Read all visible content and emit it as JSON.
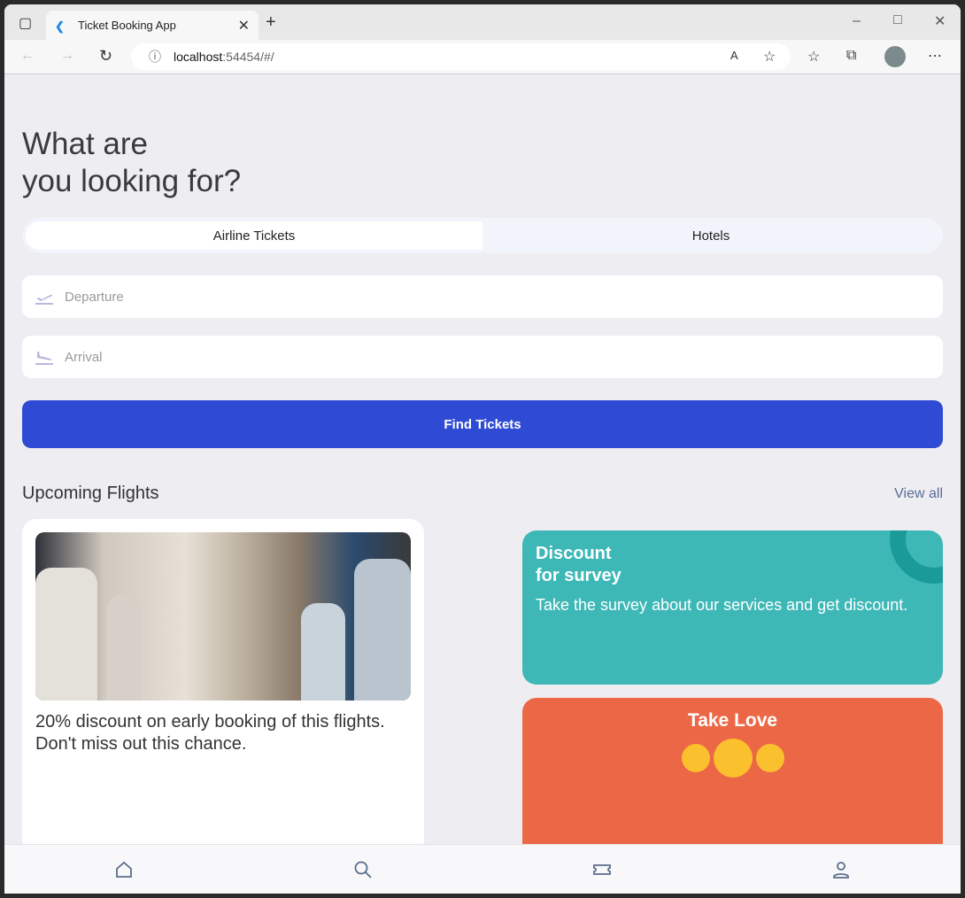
{
  "browser": {
    "tab_title": "Ticket Booking App",
    "url_host": "localhost",
    "url_rest": ":54454/#/"
  },
  "header": {
    "title_line1": "What are",
    "title_line2": "you looking for?"
  },
  "segments": [
    {
      "label": "Airline Tickets",
      "selected": true
    },
    {
      "label": "Hotels",
      "selected": false
    }
  ],
  "form": {
    "departure_placeholder": "Departure",
    "arrival_placeholder": "Arrival",
    "find_label": "Find Tickets"
  },
  "upcoming": {
    "title": "Upcoming Flights",
    "view_all": "View all",
    "card_text": "20% discount on early booking of this flights. Don't miss out this chance."
  },
  "survey": {
    "title_line1": "Discount",
    "title_line2": "for survey",
    "text": "Take the survey about our services and get discount.",
    "color": "#3db8b7"
  },
  "love": {
    "title": "Take Love",
    "color": "#ec6745"
  },
  "nav": [
    "home-icon",
    "search-icon",
    "ticket-icon",
    "profile-icon"
  ],
  "accent": "#2f4bd3"
}
